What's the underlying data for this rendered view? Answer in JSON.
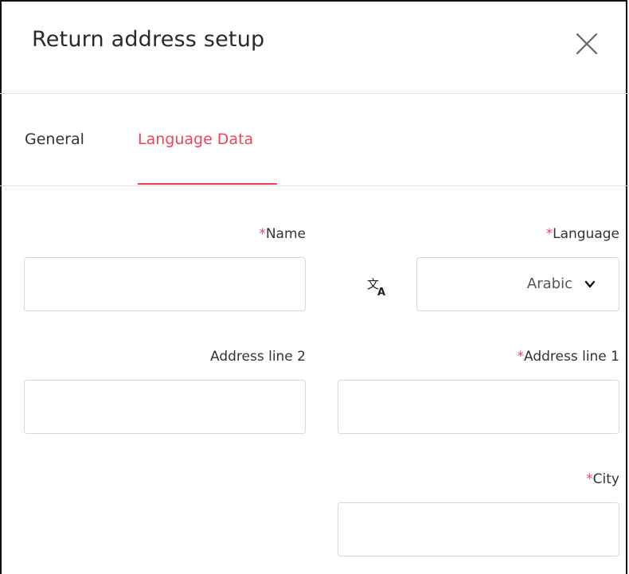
{
  "dialog": {
    "title": "Return address setup"
  },
  "tabs": [
    {
      "label": "General",
      "active": false
    },
    {
      "label": "Language Data",
      "active": true
    }
  ],
  "form": {
    "required_marker": "*",
    "name": {
      "label": "Name",
      "required": true,
      "value": ""
    },
    "language": {
      "label": "Language",
      "required": true,
      "value": "Arabic"
    },
    "address_line_2": {
      "label": "Address line 2",
      "required": false,
      "value": ""
    },
    "address_line_1": {
      "label": "Address line 1",
      "required": true,
      "value": ""
    },
    "city": {
      "label": "City",
      "required": true,
      "value": ""
    }
  },
  "icons": {
    "close": "close-icon",
    "translate": "translate-icon",
    "dropdown": "chevron-down-icon"
  },
  "colors": {
    "accent": "#f0425f",
    "border": "#d8d8d8",
    "divider": "#e3e3e3"
  }
}
